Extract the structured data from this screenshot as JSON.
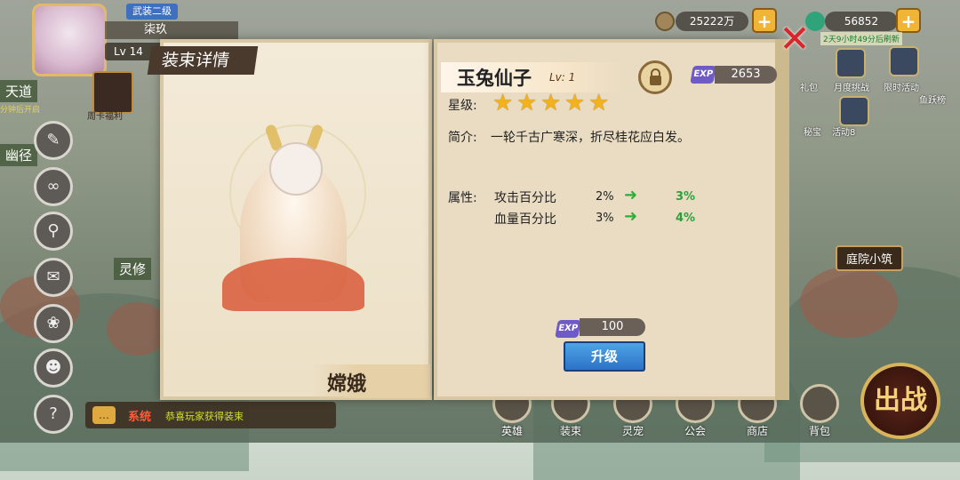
{
  "player": {
    "vip": "武装二级",
    "name": "柒玖",
    "level": "Lv 14"
  },
  "resources": {
    "gold": "25222万",
    "jade": "56852",
    "jade_note": "2天9小时49分后刷新"
  },
  "left_hud": {
    "area1": "天道",
    "area1_sub": "分钟后开启",
    "area2": "幽径",
    "area3": "灵修",
    "week_card": "周卡福利"
  },
  "top_icons": [
    "礼包",
    "月度挑战",
    "限时活动",
    "鱼跃榜",
    "秘宝",
    "活动8"
  ],
  "buildings": {
    "courtyard": "庭院小筑"
  },
  "chat": {
    "channel": "系统",
    "text": "恭喜玩家获得装束"
  },
  "bottom_nav": [
    {
      "label": "英雄"
    },
    {
      "label": "装束"
    },
    {
      "label": "灵宠"
    },
    {
      "label": "公会"
    },
    {
      "label": "商店"
    },
    {
      "label": "背包"
    }
  ],
  "battle_label": "出战",
  "portrait": {
    "header": "装束详情",
    "character": "嫦娥"
  },
  "detail": {
    "name": "玉兔仙子",
    "level": "Lv: 1",
    "exp_total": "2653",
    "star_label": "星级:",
    "stars": 5,
    "intro_label": "简介:",
    "intro_text": "一轮千古广寒深，折尽桂花应白发。",
    "attr_label": "属性:",
    "attributes": [
      {
        "name": "攻击百分比",
        "current": "2%",
        "next": "3%"
      },
      {
        "name": "血量百分比",
        "current": "3%",
        "next": "4%"
      }
    ],
    "upgrade_cost": "100",
    "upgrade_button": "升级",
    "exp_icon": "EXP"
  },
  "colors": {
    "accent_blue": "#2d72c7",
    "gain_green": "#27a23c",
    "star_gold": "#f3b21c",
    "close_red": "#d8262a"
  }
}
